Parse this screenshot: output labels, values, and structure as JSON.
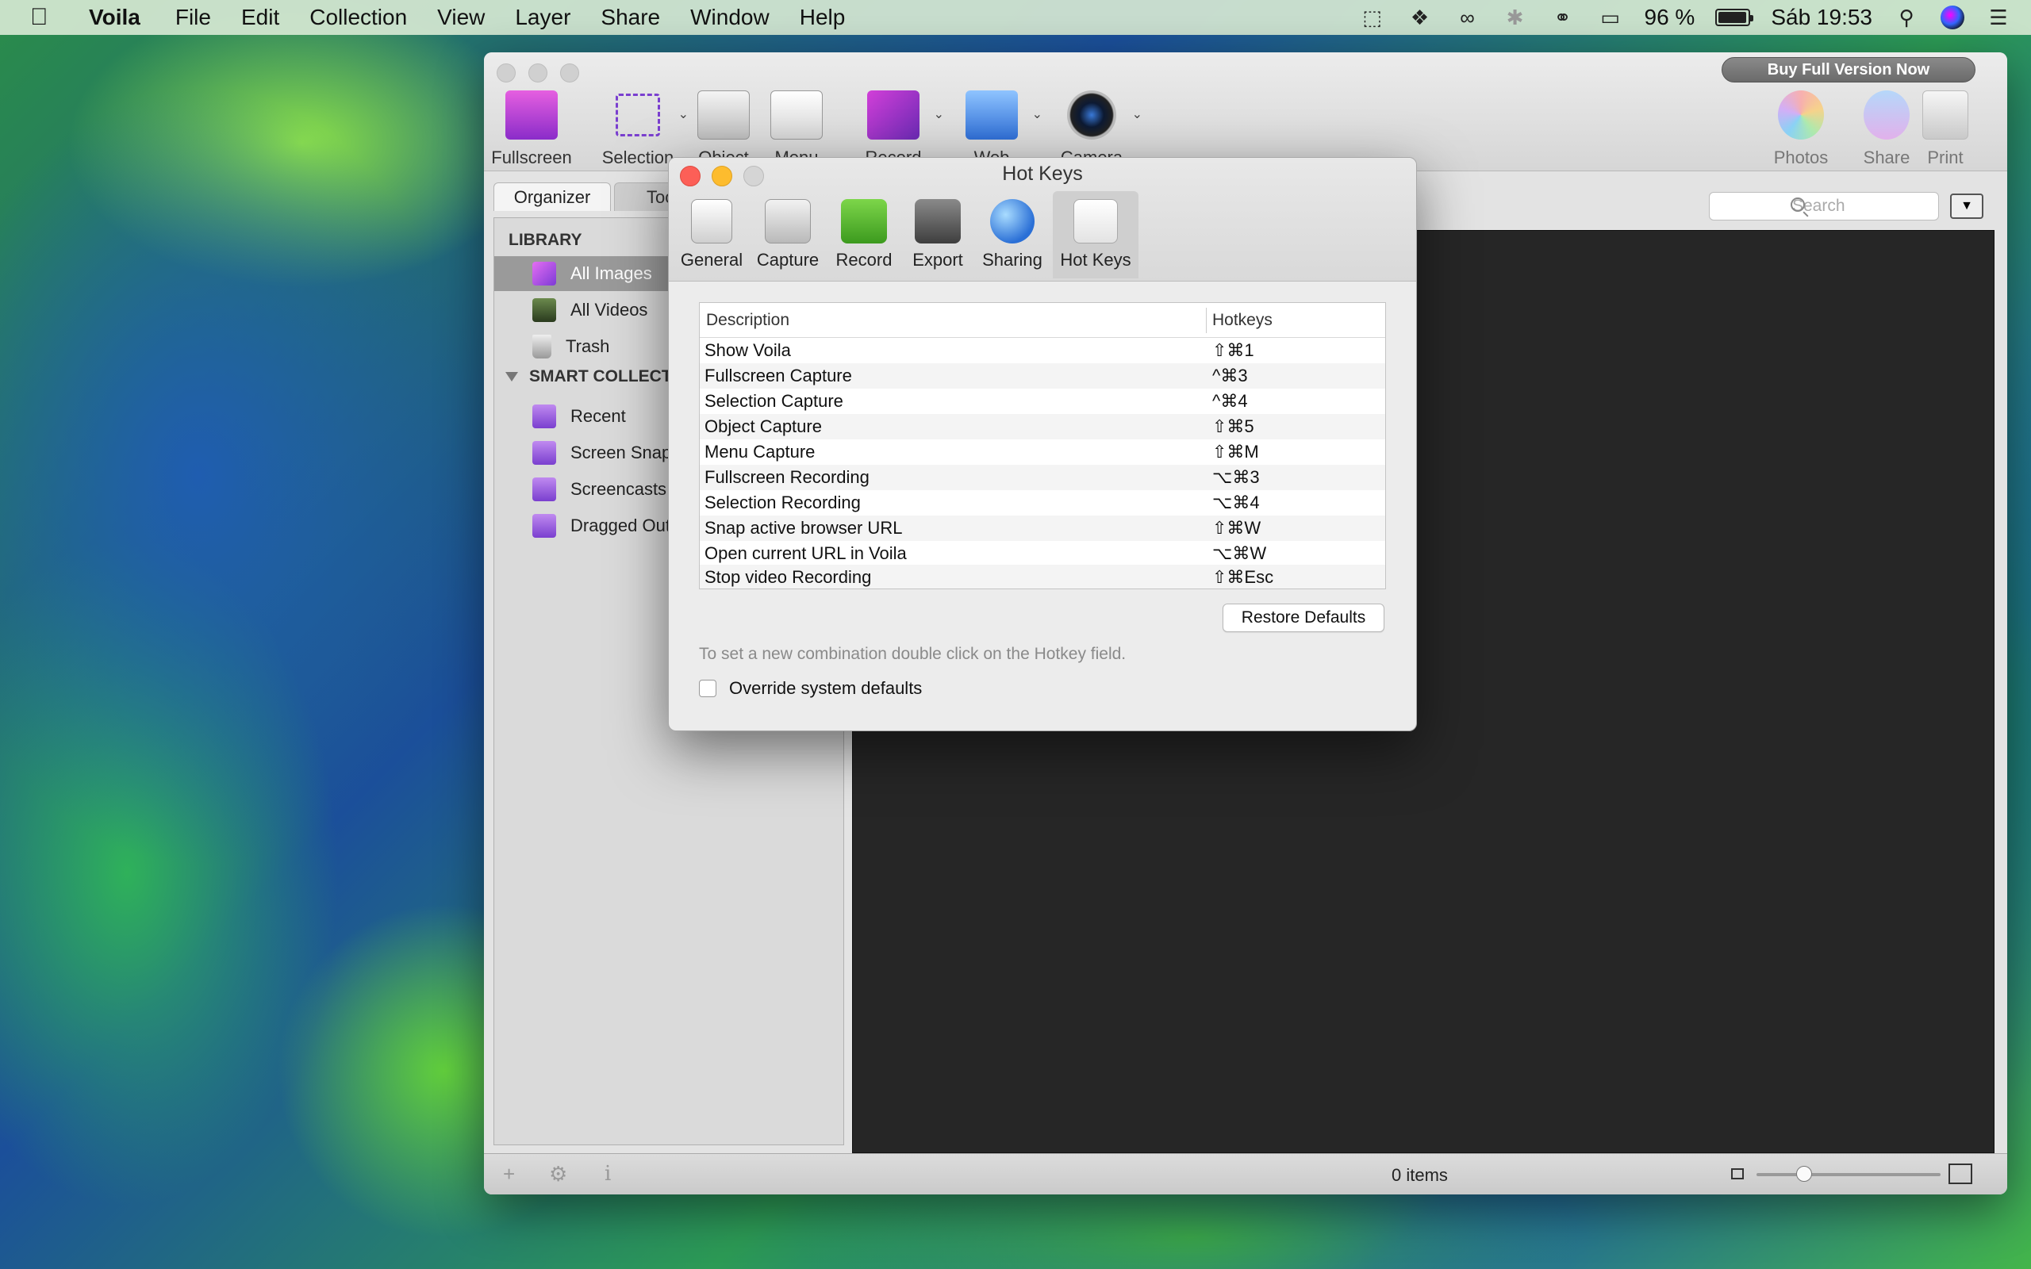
{
  "menubar": {
    "app_name": "Voila",
    "items": [
      "File",
      "Edit",
      "Collection",
      "View",
      "Layer",
      "Share",
      "Window",
      "Help"
    ],
    "battery_percent": "96 %",
    "battery_level": 0.96,
    "clock": "Sáb 19:53",
    "status_icons": [
      "crop-icon",
      "dropbox-icon",
      "creative-cloud-icon",
      "bluetooth-icon",
      "wifi-icon",
      "airplay-icon",
      "battery-icon",
      "spotlight-icon",
      "siri-icon",
      "notification-center-icon"
    ]
  },
  "main": {
    "buy_label": "Buy Full Version Now",
    "toolbar": {
      "fullscreen": "Fullscreen",
      "selection": "Selection",
      "object": "Object",
      "menu": "Menu",
      "record": "Record",
      "web": "Web",
      "camera": "Camera",
      "photos": "Photos",
      "share": "Share",
      "print": "Print"
    },
    "tabs": {
      "organizer": "Organizer",
      "tools": "Tools"
    },
    "search_placeholder": "Search",
    "sidebar": {
      "library_header": "LIBRARY",
      "library_items": [
        "All Images",
        "All Videos",
        "Trash"
      ],
      "smart_header": "SMART COLLECTIONS",
      "smart_items": [
        "Recent",
        "Screen Snaps",
        "Screencasts",
        "Dragged Out"
      ]
    },
    "status_count": "0 items",
    "zoom_level": 0.26,
    "accent": "#7a3fcf"
  },
  "dialog": {
    "title": "Hot Keys",
    "tabs": [
      "General",
      "Capture",
      "Record",
      "Export",
      "Sharing",
      "Hot Keys"
    ],
    "selected_tab": "Hot Keys",
    "table": {
      "headers": [
        "Description",
        "Hotkeys"
      ],
      "rows": [
        [
          "Show Voila",
          "⇧⌘1"
        ],
        [
          "Fullscreen Capture",
          "^⌘3"
        ],
        [
          "Selection Capture",
          "^⌘4"
        ],
        [
          "Object Capture",
          "⇧⌘5"
        ],
        [
          "Menu Capture",
          "⇧⌘M"
        ],
        [
          "Fullscreen Recording",
          "⌥⌘3"
        ],
        [
          "Selection Recording",
          "⌥⌘4"
        ],
        [
          "Snap active browser URL",
          "⇧⌘W"
        ],
        [
          "Open current URL in Voila",
          "⌥⌘W"
        ],
        [
          "Stop video Recording",
          "⇧⌘Esc"
        ]
      ]
    },
    "restore_label": "Restore Defaults",
    "hint": "To set a new combination double click on the Hotkey field.",
    "override_label": "Override system defaults"
  }
}
